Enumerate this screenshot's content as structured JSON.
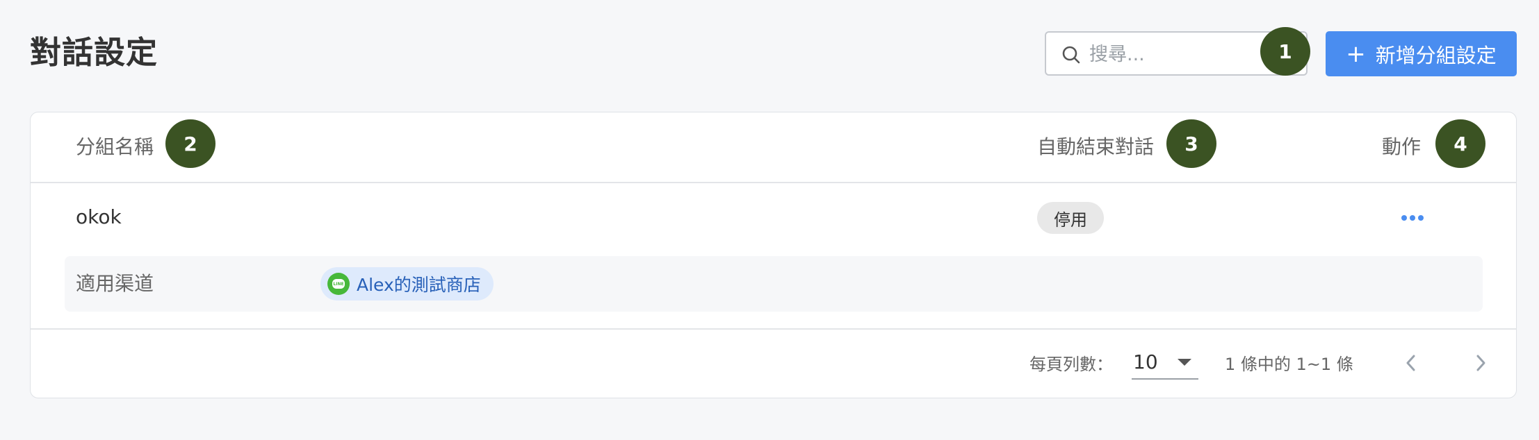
{
  "page": {
    "title": "對話設定"
  },
  "search": {
    "placeholder": "搜尋...",
    "value": ""
  },
  "toolbar": {
    "add_label": "新增分組設定",
    "add_icon": "+"
  },
  "table": {
    "columns": {
      "name": "分組名稱",
      "auto_end": "自動結束對話",
      "action": "動作"
    },
    "rows": [
      {
        "name": "okok",
        "status": "停用",
        "channel_label": "適用渠道",
        "channels": [
          {
            "name": "Alex的測試商店",
            "icon": "line-icon"
          }
        ]
      }
    ]
  },
  "pagination": {
    "rows_per_page_label": "每頁列數：",
    "rows_per_page_value": "10",
    "range_text": "1 條中的 1~1 條"
  },
  "markers": [
    "1",
    "2",
    "3",
    "4"
  ],
  "colors": {
    "primary": "#4a8df0",
    "marker": "#3b5323",
    "line_green": "#47b83a",
    "chip_bg": "#deeafc"
  }
}
